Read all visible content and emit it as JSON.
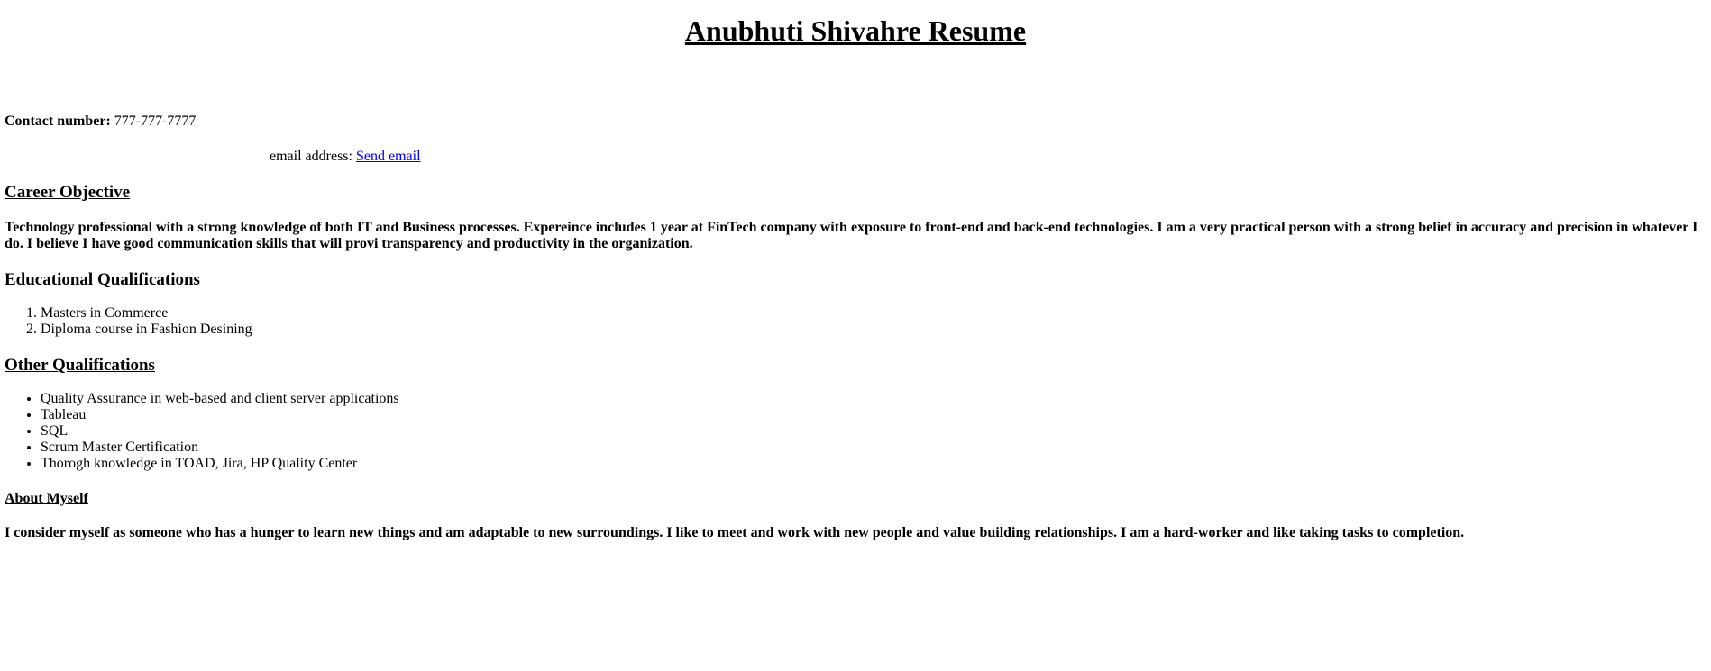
{
  "title": "Anubhuti Shivahre Resume",
  "contact": {
    "label": "Contact number:",
    "value": "777-777-7777"
  },
  "email": {
    "label": "email address:",
    "link_text": "Send email"
  },
  "career": {
    "heading": "Career Objective",
    "text": "Technology professional with a strong knowledge of both IT and Business processes. Expereince includes 1 year at FinTech company with exposure to front-end and back-end technologies. I am a very practical person with a strong belief in accuracy and precision in whatever I do. I believe I have good communication skills that will provi transparency and productivity in the organization."
  },
  "education": {
    "heading": "Educational Qualifications",
    "items": [
      "Masters in Commerce",
      "Diploma course in Fashion Desining"
    ]
  },
  "other": {
    "heading": "Other Qualifications",
    "items": [
      "Quality Assurance in web-based and client server applications",
      "Tableau",
      "SQL",
      "Scrum Master Certification",
      "Thorogh knowledge in TOAD, Jira, HP Quality Center"
    ]
  },
  "about": {
    "heading": "About Myself",
    "text": "I consider myself as someone who has a hunger to learn new things and am adaptable to new surroundings. I like to meet and work with new people and value building relationships. I am a hard-worker and like taking tasks to completion."
  },
  "colors": {
    "link": "#0000ee",
    "text": "#000000",
    "background": "#ffffff"
  }
}
